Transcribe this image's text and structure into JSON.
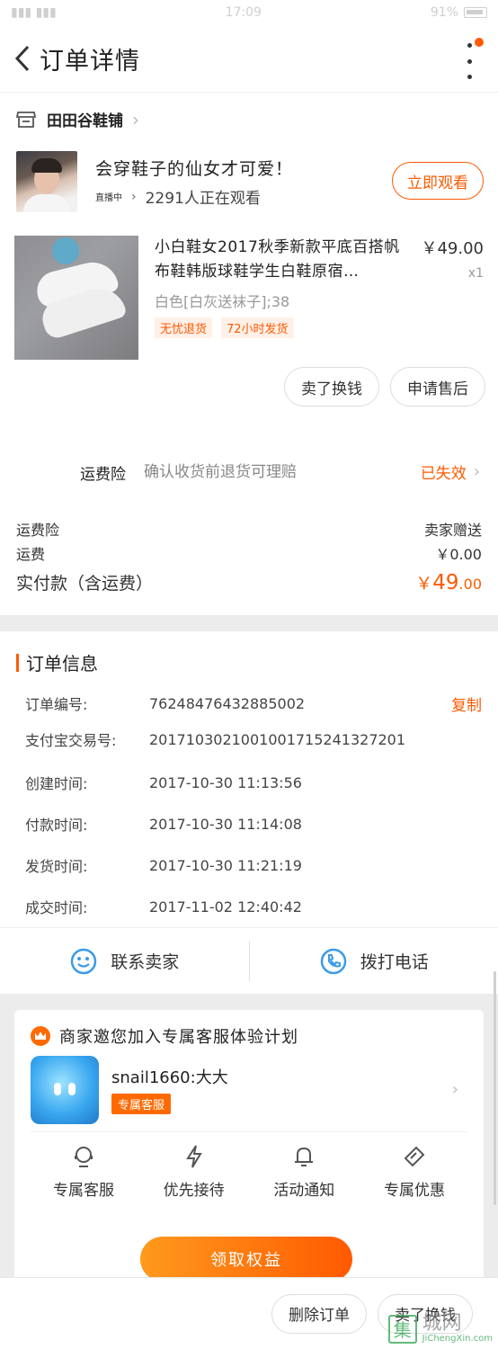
{
  "status_bar": {
    "time": "17:09",
    "battery": "91%"
  },
  "nav": {
    "title": "订单详情"
  },
  "shop": {
    "name": "田田谷鞋铺"
  },
  "live": {
    "title": "会穿鞋子的仙女才可爱！",
    "badge": "直播中",
    "viewers": "2291人正在观看",
    "watch_button": "立即观看"
  },
  "product": {
    "title": "小白鞋女2017秋季新款平底百搭帆布鞋韩版球鞋学生白鞋原宿…",
    "sku": "白色[白灰送袜子];38",
    "tags": [
      "无忧退货",
      "72小时发货"
    ],
    "price": "￥49.00",
    "qty": "x1"
  },
  "actions": {
    "sell": "卖了换钱",
    "after_sale": "申请售后"
  },
  "insurance": {
    "label": "运费险",
    "desc": "确认收货前退货可理赔",
    "status": "已失效"
  },
  "fees": {
    "rows": [
      {
        "label": "运费险",
        "value": "卖家赠送"
      },
      {
        "label": "运费",
        "value": "￥0.00"
      }
    ],
    "total_label": "实付款（含运费）",
    "total_symbol": "￥",
    "total_int": "49",
    "total_dec": ".00"
  },
  "order_info": {
    "heading": "订单信息",
    "copy": "复制",
    "rows": [
      {
        "key": "订单编号:",
        "value": "76248476432885002"
      },
      {
        "key": "支付宝交易号:",
        "value": "2017103021001001715241327201"
      },
      {
        "key": "创建时间:",
        "value": "2017-10-30 11:13:56"
      },
      {
        "key": "付款时间:",
        "value": "2017-10-30 11:14:08"
      },
      {
        "key": "发货时间:",
        "value": "2017-10-30 11:21:19"
      },
      {
        "key": "成交时间:",
        "value": "2017-11-02 12:40:42"
      }
    ]
  },
  "contact": {
    "seller": "联系卖家",
    "phone": "拨打电话"
  },
  "service": {
    "title": "商家邀您加入专属客服体验计划",
    "agent_name": "snail1660:大大",
    "agent_tag": "专属客服",
    "benefits": [
      "专属客服",
      "优先接待",
      "活动通知",
      "专属优惠"
    ],
    "claim_button": "领取权益"
  },
  "bottom": {
    "delete": "删除订单",
    "sell": "卖了换钱"
  },
  "watermark": {
    "logo": "集",
    "cn": "城网",
    "en": "JiChengXin.com"
  },
  "colors": {
    "accent": "#ff5a00",
    "blue": "#3b9be6"
  }
}
